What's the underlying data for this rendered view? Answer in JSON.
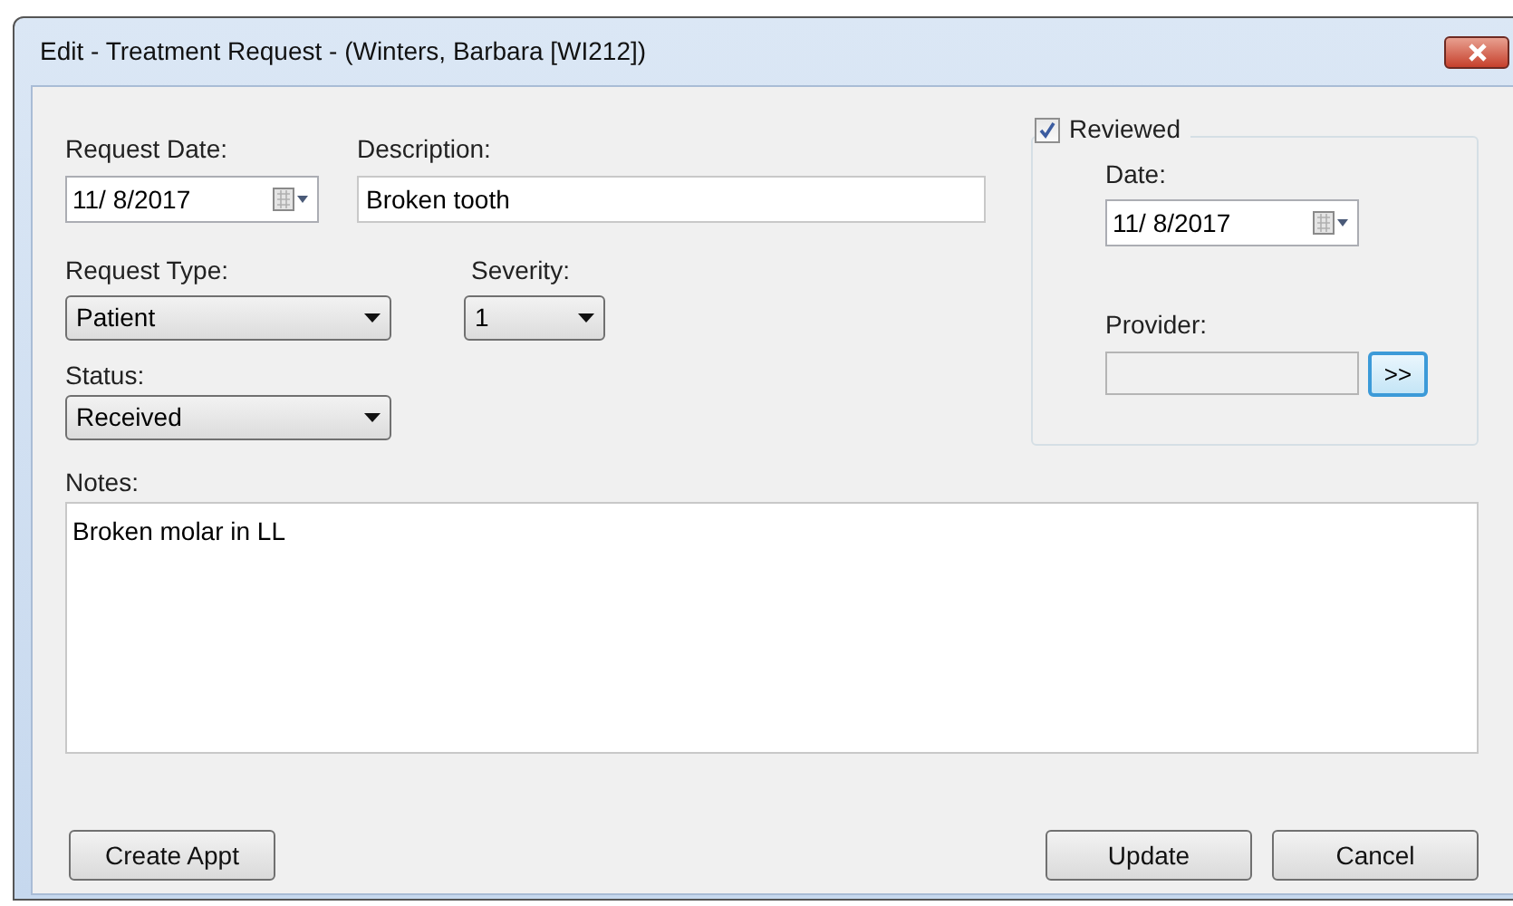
{
  "window": {
    "title": "Edit - Treatment Request - (Winters, Barbara [WI212])"
  },
  "request_date": {
    "label": "Request Date:",
    "value": "11/ 8/2017"
  },
  "description": {
    "label": "Description:",
    "value": "Broken tooth"
  },
  "request_type": {
    "label": "Request Type:",
    "value": "Patient"
  },
  "severity": {
    "label": "Severity:",
    "value": "1"
  },
  "status": {
    "label": "Status:",
    "value": "Received"
  },
  "reviewed": {
    "label": "Reviewed",
    "checked": true,
    "date": {
      "label": "Date:",
      "value": "11/ 8/2017"
    },
    "provider": {
      "label": "Provider:",
      "disabled": true,
      "button": ">>"
    }
  },
  "notes": {
    "label": "Notes:",
    "value": "Broken molar in LL"
  },
  "buttons": {
    "left": [
      "Create Appt"
    ],
    "right": [
      "Update",
      "Cancel"
    ]
  }
}
